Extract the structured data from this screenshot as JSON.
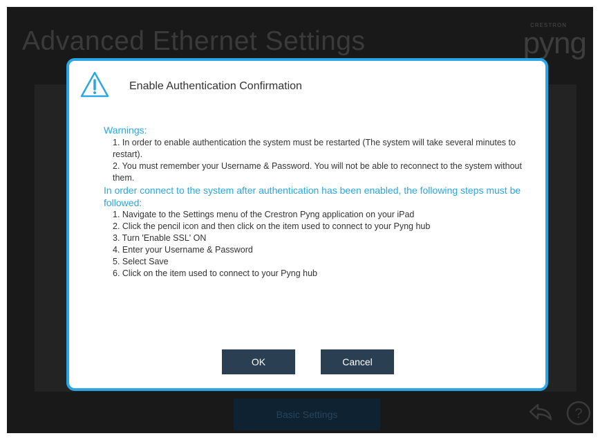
{
  "background": {
    "page_title": "Advanced Ethernet Settings",
    "logo_small": "CRESTRON",
    "logo_big": "pyng",
    "bottom_button_label": "Basic Settings",
    "help_label": "?"
  },
  "dialog": {
    "title": "Enable Authentication Confirmation",
    "warnings_heading": "Warnings:",
    "warnings": [
      "1. In order to enable authentication the system must be restarted (The system will take several minutes to restart).",
      "2. You must remember your Username & Password. You will not be able to reconnect to the system without them."
    ],
    "steps_heading": "In order connect to the system after authentication has been enabled, the following steps must be followed:",
    "steps": [
      "1. Navigate to the Settings menu of the Crestron Pyng application on your iPad",
      "2. Click the pencil icon and then click on the item used to connect to your Pyng hub",
      "3. Turn 'Enable SSL' ON",
      "4. Enter your Username & Password",
      "5. Select Save",
      "6. Click on the item used to connect to your Pyng hub"
    ],
    "ok_label": "OK",
    "cancel_label": "Cancel"
  },
  "colors": {
    "accent": "#2aa6e4",
    "button": "#2b3f52",
    "backdrop": "#191919"
  }
}
